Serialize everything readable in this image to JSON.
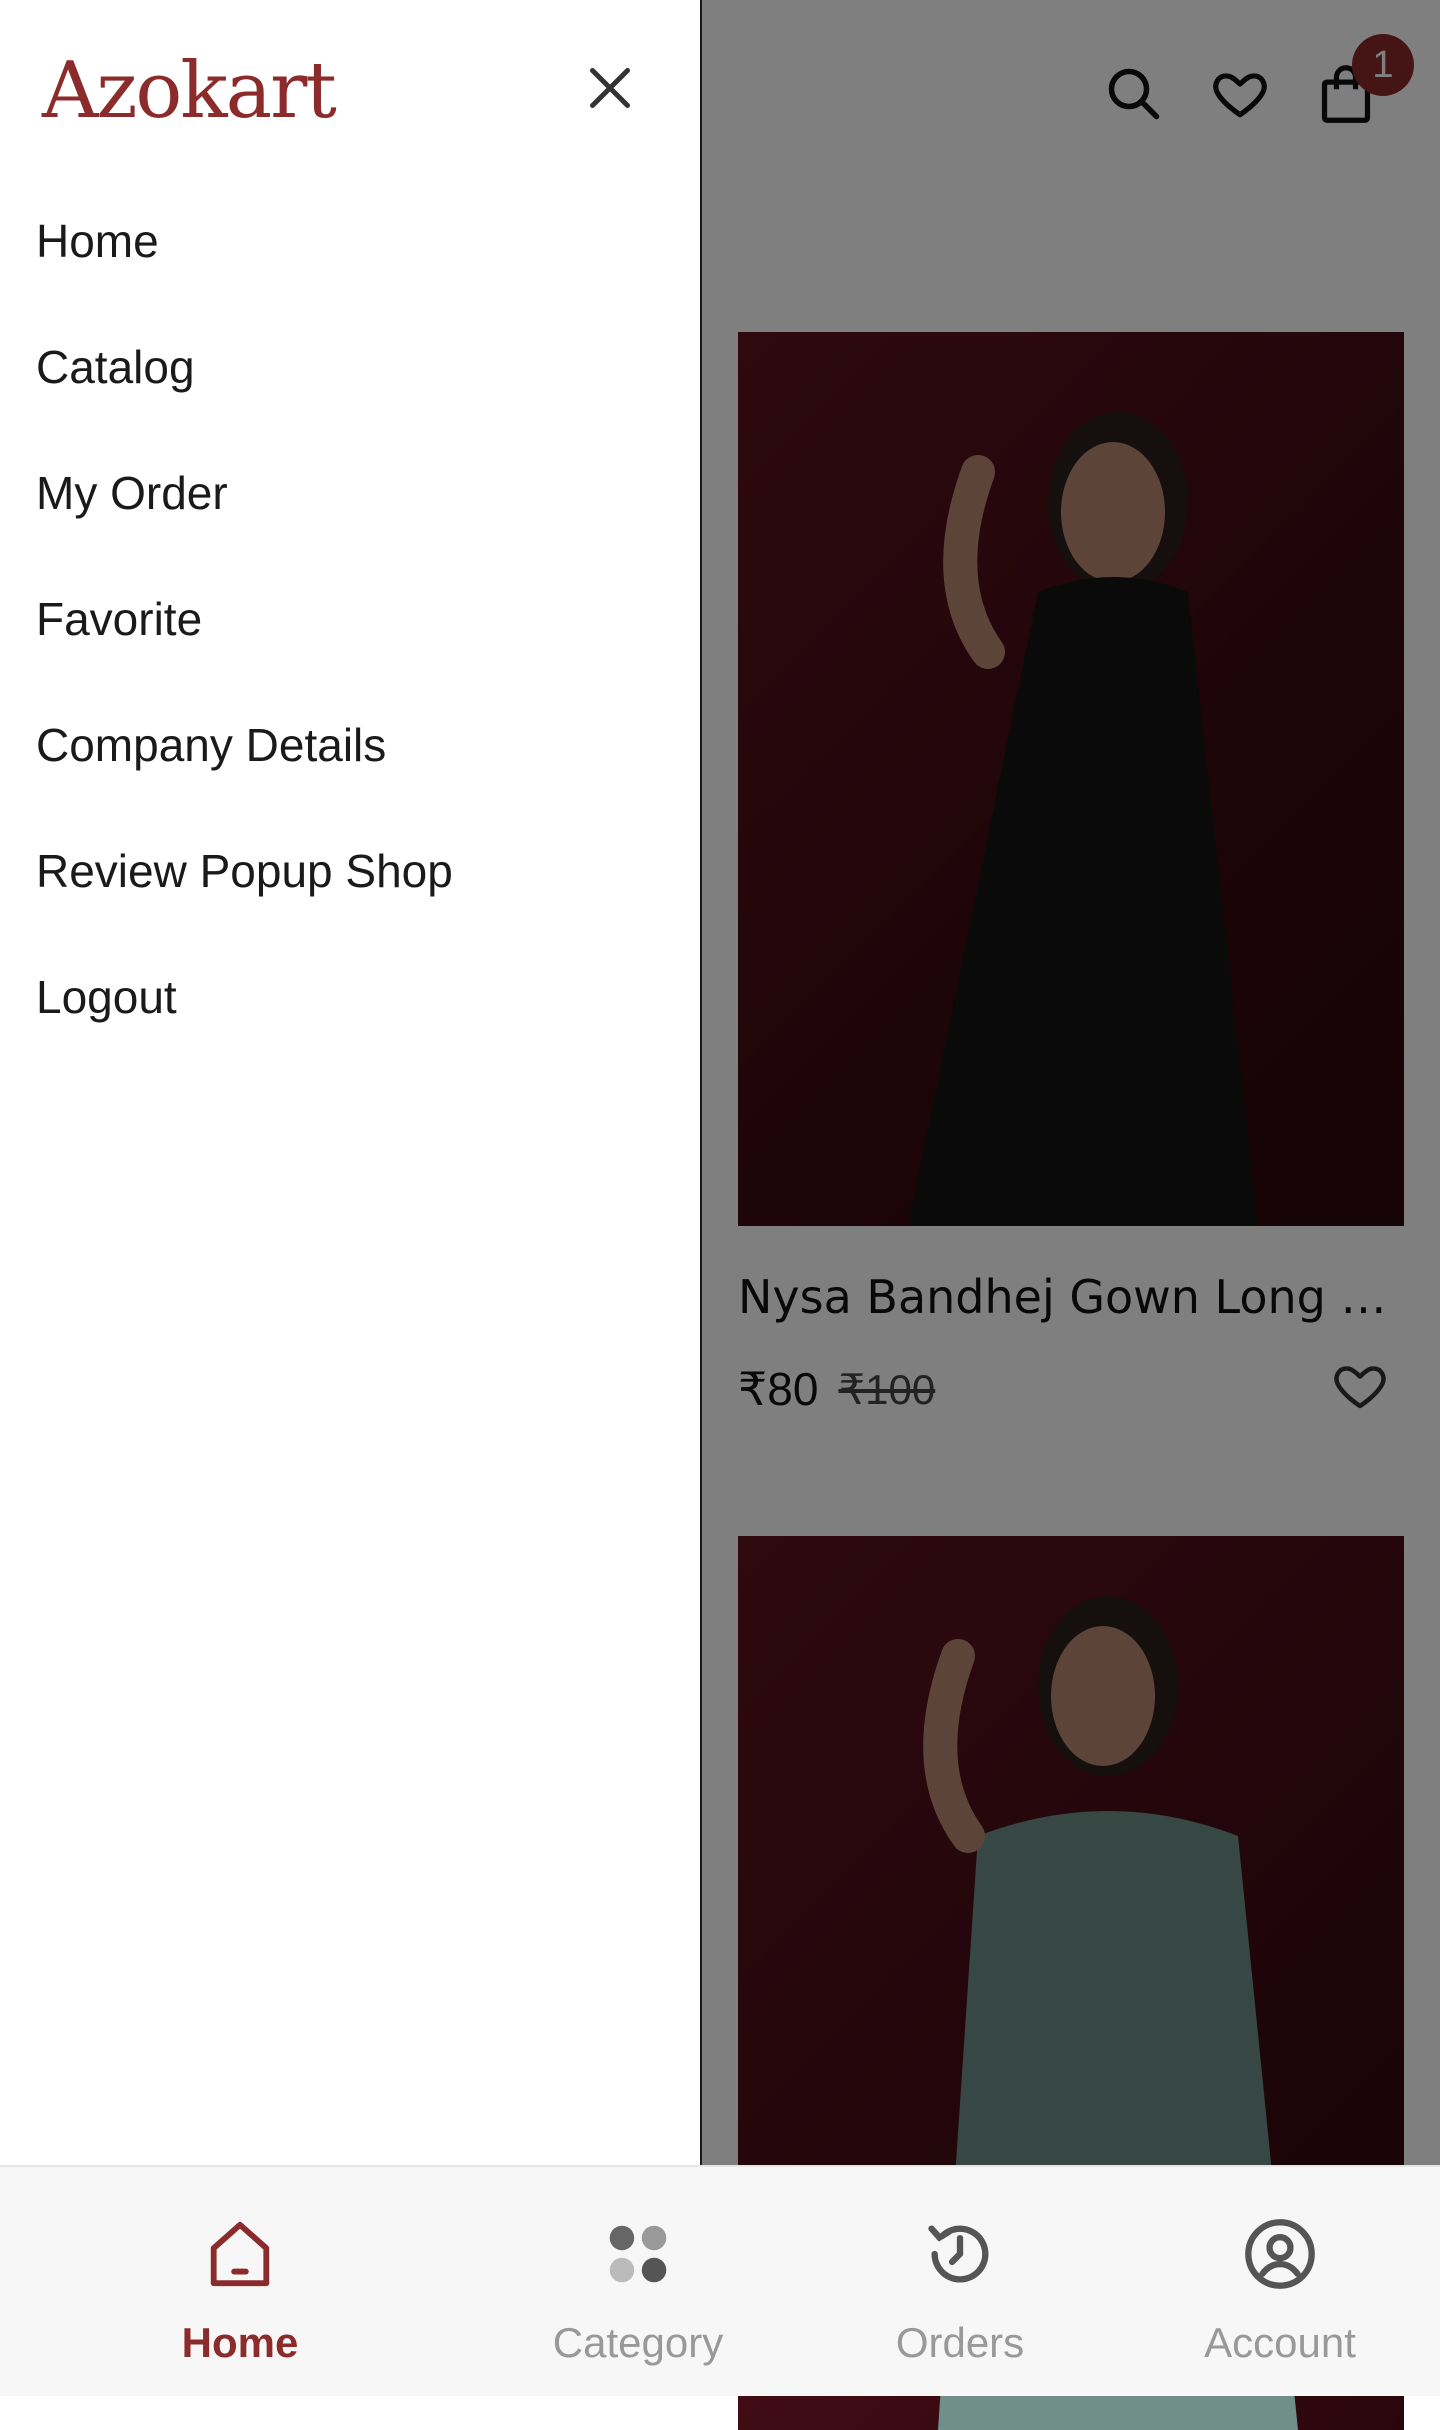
{
  "brand": {
    "name": "Azokart",
    "color": "#8b2b2b"
  },
  "drawer": {
    "close_icon": "close-icon",
    "menu": [
      {
        "label": "Home"
      },
      {
        "label": "Catalog"
      },
      {
        "label": "My Order"
      },
      {
        "label": "Favorite"
      },
      {
        "label": "Company Details"
      },
      {
        "label": "Review Popup Shop"
      },
      {
        "label": "Logout"
      }
    ]
  },
  "header": {
    "icons": [
      "search-icon",
      "heart-icon",
      "shopping-bag-icon"
    ],
    "cart_count": "1"
  },
  "products": [
    {
      "title": "Nysa Bandhej Gown Long Anar...",
      "price": "₹80",
      "old_price": "₹100",
      "image": "model-black-saree"
    },
    {
      "image": "model-teal-saree"
    }
  ],
  "bottom_nav": {
    "items": [
      {
        "label": "Home",
        "icon": "home-icon",
        "active": true
      },
      {
        "label": "Category",
        "icon": "category-icon",
        "active": false
      },
      {
        "label": "Orders",
        "icon": "history-icon",
        "active": false
      },
      {
        "label": "Account",
        "icon": "account-icon",
        "active": false
      }
    ]
  },
  "colors": {
    "accent": "#8b2b2b",
    "overlay": "#00000080",
    "inactive": "#999999"
  }
}
